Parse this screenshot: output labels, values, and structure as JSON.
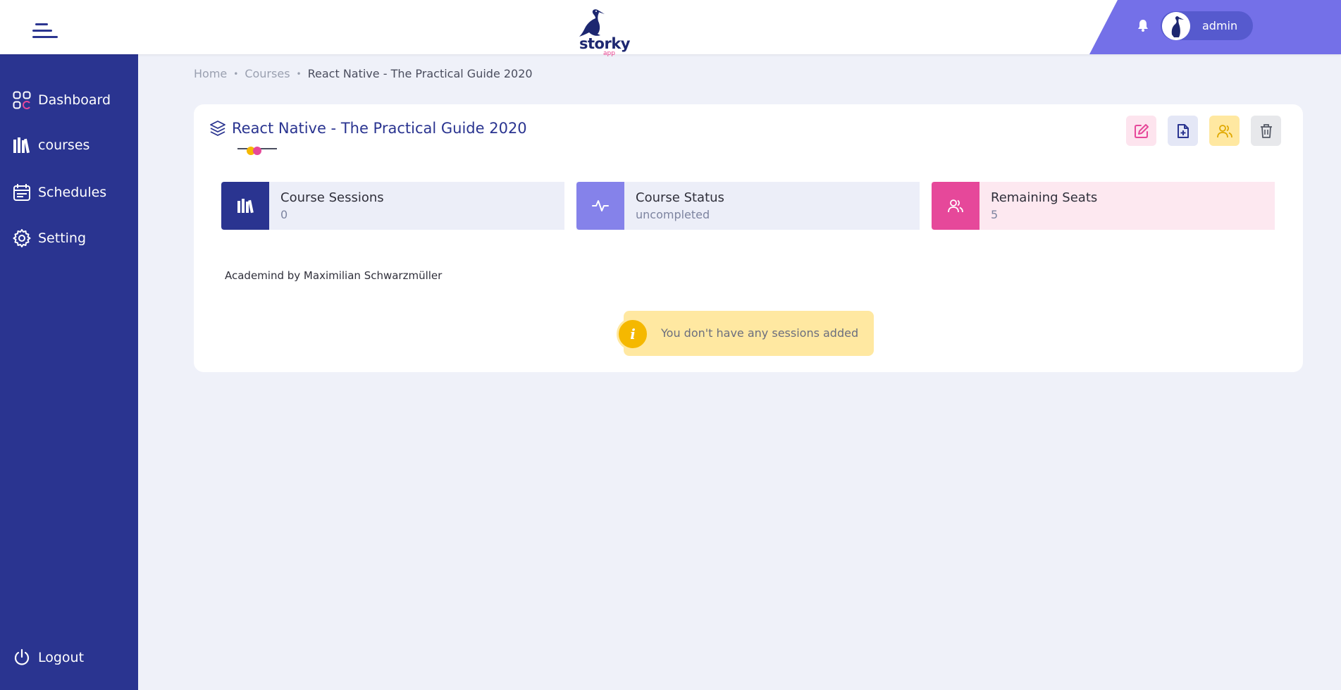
{
  "app": {
    "logo_text": "storky",
    "logo_sub": "app"
  },
  "header": {
    "user_name": "admin"
  },
  "sidebar": {
    "items": [
      {
        "label": "Dashboard",
        "icon": "dashboard-icon"
      },
      {
        "label": "courses",
        "icon": "books-icon"
      },
      {
        "label": "Schedules",
        "icon": "calendar-icon"
      },
      {
        "label": "Setting",
        "icon": "gear-icon"
      }
    ],
    "logout_label": "Logout"
  },
  "breadcrumb": {
    "home": "Home",
    "courses": "Courses",
    "current": "React Native - The Practical Guide 2020"
  },
  "course": {
    "title": "React Native - The Practical Guide 2020",
    "instructor": "Academind by Maximilian Schwarzmüller",
    "stats": [
      {
        "label": "Course Sessions",
        "value": "0",
        "icon": "books-icon"
      },
      {
        "label": "Course Status",
        "value": "uncompleted",
        "icon": "activity-icon"
      },
      {
        "label": "Remaining Seats",
        "value": "5",
        "icon": "users-icon"
      }
    ],
    "actions": [
      "edit",
      "add-session",
      "students",
      "delete"
    ]
  },
  "alert": {
    "icon_text": "i",
    "message": "You don't have any sessions added"
  },
  "colors": {
    "primary": "#2a3490",
    "accent": "#7470e8",
    "pink": "#e6489a",
    "warning": "#f5b800"
  }
}
